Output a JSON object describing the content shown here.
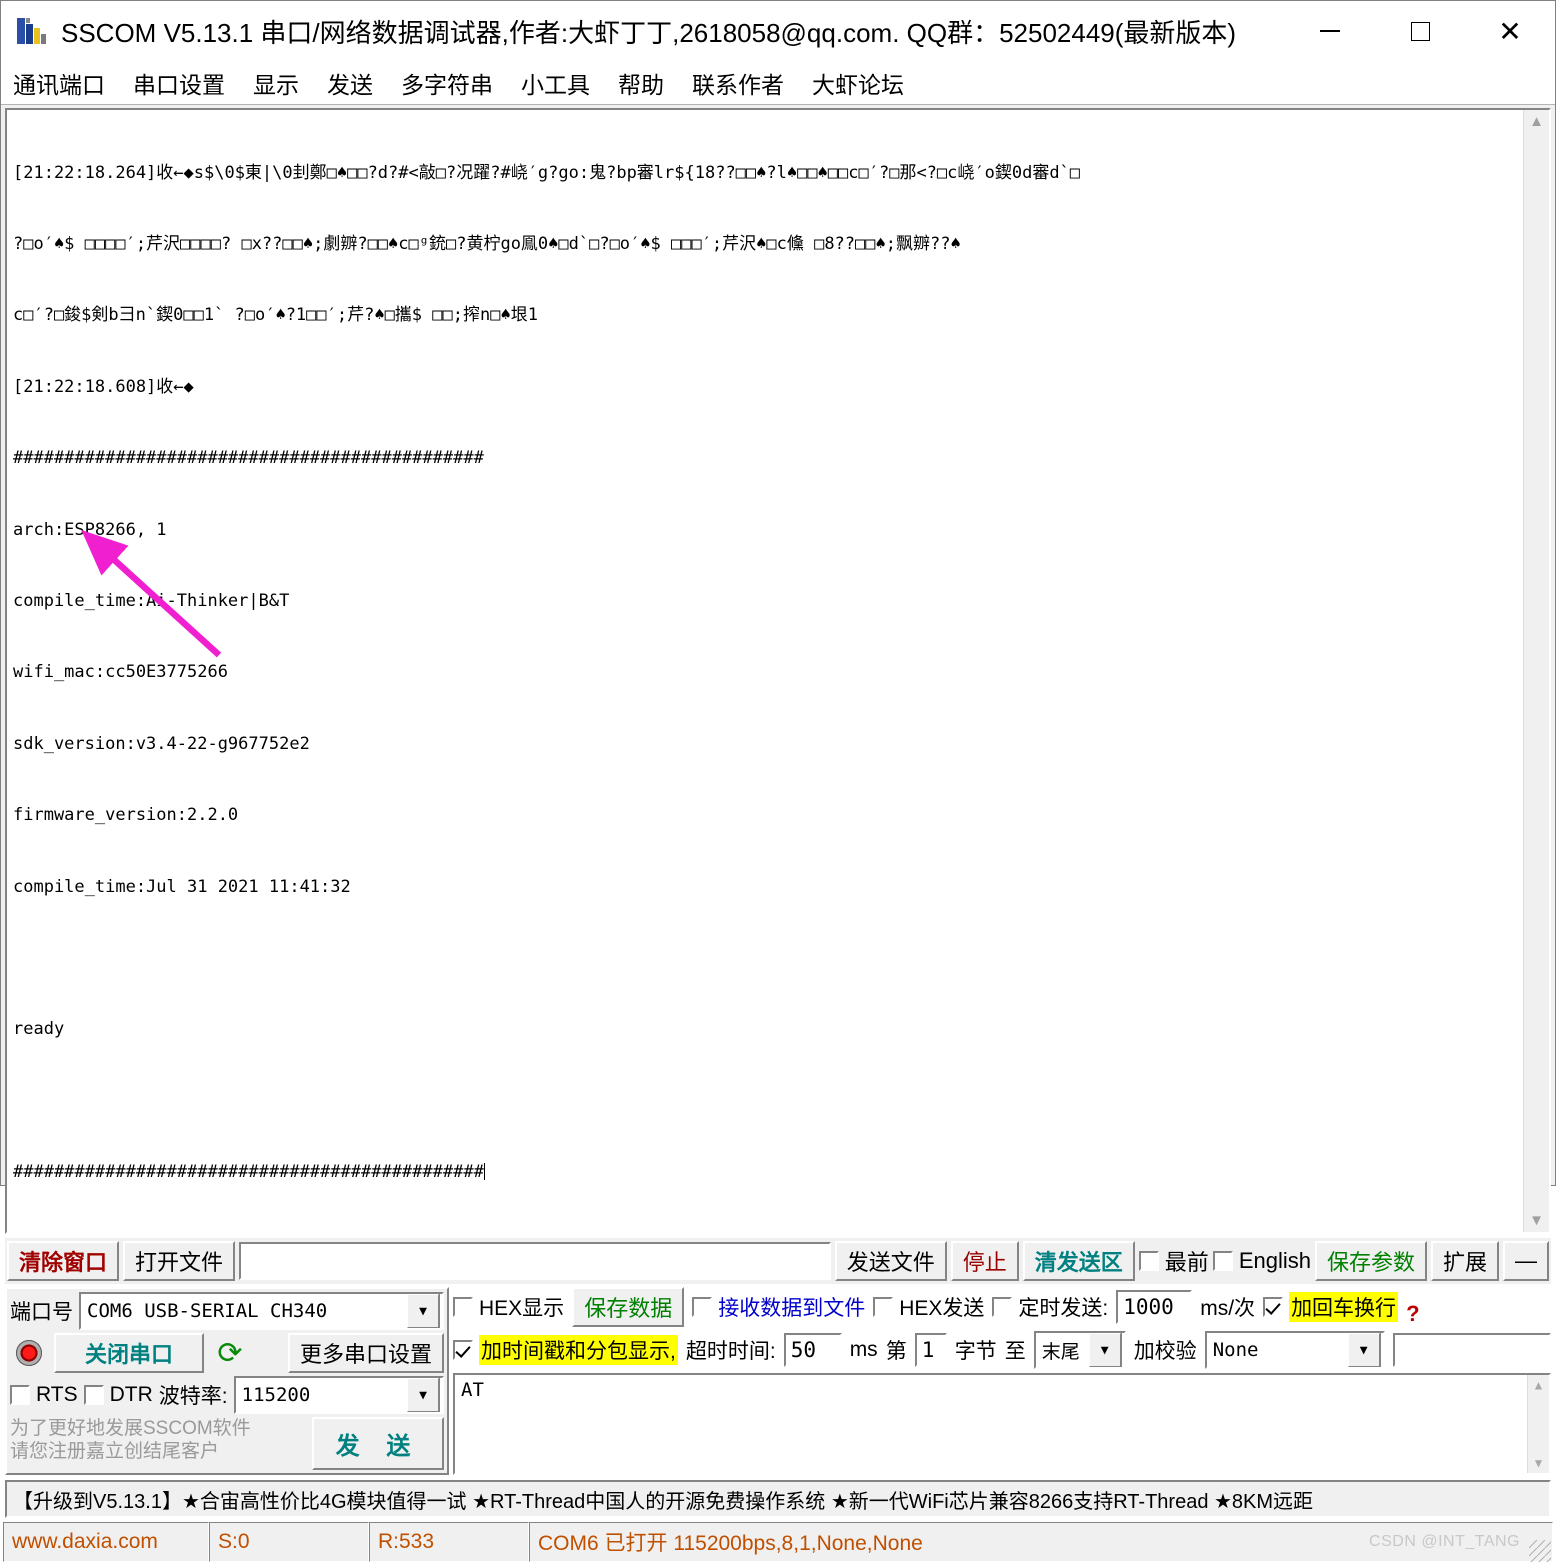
{
  "window": {
    "title": "SSCOM V5.13.1 串口/网络数据调试器,作者:大虾丁丁,2618058@qq.com. QQ群：52502449(最新版本)",
    "minimize_label": "–",
    "maximize_label": "□",
    "close_label": "✕",
    "icon": "sscom-app-icon"
  },
  "menu": {
    "items": [
      {
        "label": "通讯端口"
      },
      {
        "label": "串口设置"
      },
      {
        "label": "显示"
      },
      {
        "label": "发送"
      },
      {
        "label": "多字符串"
      },
      {
        "label": "小工具"
      },
      {
        "label": "帮助"
      },
      {
        "label": "联系作者"
      },
      {
        "label": "大虾论坛"
      }
    ]
  },
  "receive": {
    "lines": [
      "[21:22:18.264]收←◆s$\\0$東|\\0刲鄭□♠□□?d?#<敲□?况躍?#峣′g?go:鬼?bp審lr${18??□□♠?l♠□□♠□□c□′?□那<?□c峣′o鍥0d審d`□",
      "?□o′♠$ □□□□′;芹沢□□□□? □x??□□♠;劇辧?□□♠c□ᵍ銃□?黄柠go鳯0♠□d`□?□o′♠$ □□□′;芹沢♠□c儵 □8??□□♠;飘辧??♠",
      "c□′?□鋑$剣b彐n`鍥0□□1` ?□o′♠?1□□′;芹?♠□攜$ □□;搾n□♠垠1",
      "[21:22:18.608]收←◆",
      "##############################################",
      "arch:ESP8266, 1",
      "compile_time:Ai-Thinker|B&T",
      "wifi_mac:cc50E3775266",
      "sdk_version:v3.4-22-g967752e2",
      "firmware_version:2.2.0",
      "compile_time:Jul 31 2021 11:41:32",
      "",
      "ready",
      "",
      "##############################################"
    ],
    "scroll_up_icon": "chevron-up-icon",
    "scroll_down_icon": "chevron-down-icon",
    "annotation_arrow_color": "#f020d0"
  },
  "toolbar": {
    "clear_window": "清除窗口",
    "open_file": "打开文件",
    "file_path_value": "",
    "send_file": "发送文件",
    "stop": "停止",
    "clear_send": "清发送区",
    "topmost_label": "最前",
    "topmost_checked": false,
    "english_label": "English",
    "english_checked": false,
    "save_params": "保存参数",
    "extend": "扩展",
    "collapse": "—"
  },
  "serial": {
    "port_label": "端口号",
    "port_value": "COM6 USB-SERIAL CH340",
    "close_port_button": "关闭串口",
    "refresh_icon": "refresh-icon",
    "led_icon": "status-led-icon",
    "more_settings_button": "更多串口设置",
    "rts_label": "RTS",
    "rts_checked": false,
    "dtr_label": "DTR",
    "dtr_checked": false,
    "baud_label": "波特率:",
    "baud_value": "115200",
    "register_note": "为了更好地发展SSCOM软件\n请您注册嘉立创结尾客户",
    "send_button": "发 送"
  },
  "options": {
    "hex_display_label": "HEX显示",
    "hex_display_checked": false,
    "save_data_button": "保存数据",
    "recv_to_file_label": "接收数据到文件",
    "recv_to_file_checked": false,
    "timestamp_label": "加时间戳和分包显示,",
    "timestamp_checked": true,
    "timeout_label": "超时时间:",
    "timeout_value": "50",
    "timeout_unit": "ms",
    "hex_send_label": "HEX发送",
    "hex_send_checked": false,
    "timed_send_label": "定时发送:",
    "timed_send_checked": false,
    "timed_send_value": "1000",
    "timed_send_unit": "ms/次",
    "crlf_label": "加回车换行",
    "crlf_checked": true,
    "help_badge": "?",
    "byte_from_label": "第",
    "byte_from_value": "1",
    "byte_label": "字节",
    "byte_to_label": "至",
    "byte_end_value": "末尾",
    "checksum_label": "加校验",
    "checksum_value": "None",
    "checksum_extra_value": ""
  },
  "send_area": {
    "text": "AT"
  },
  "marquee": {
    "text": "【升级到V5.13.1】★合宙高性价比4G模块值得一试  ★RT-Thread中国人的开源免费操作系统  ★新一代WiFi芯片兼容8266支持RT-Thread  ★8KM远距"
  },
  "status": {
    "website": "www.daxia.com",
    "sent": "S:0",
    "received": "R:533",
    "connection": "COM6 已打开  115200bps,8,1,None,None",
    "watermark": "CSDN @INT_TANG"
  }
}
